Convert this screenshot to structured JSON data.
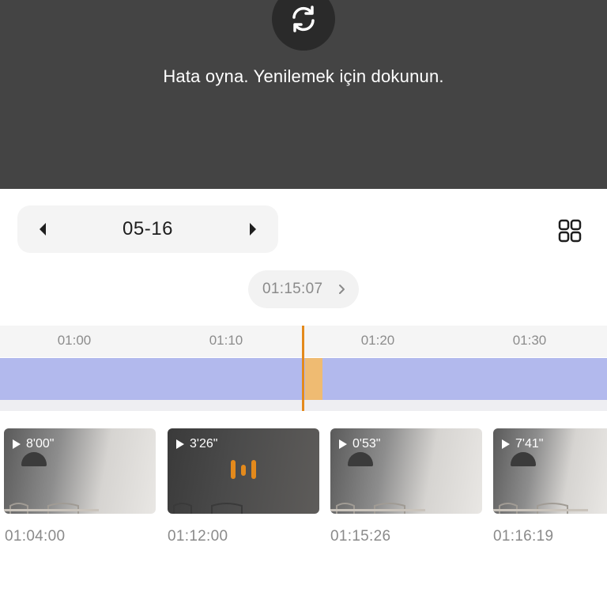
{
  "player": {
    "error_message": "Hata oyna. Yenilemek için dokunun.",
    "refresh_icon": "refresh-icon"
  },
  "date_selector": {
    "date": "05-16",
    "prev_icon": "triangle-left-icon",
    "next_icon": "triangle-right-icon"
  },
  "view_toggle": {
    "icon": "grid-icon"
  },
  "current_time": {
    "label": "01:15:07",
    "icon": "chevron-right-icon"
  },
  "timeline": {
    "ticks": [
      "01:00",
      "01:10",
      "01:20",
      "01:30"
    ],
    "colors": {
      "recording": "#b2b9ed",
      "selected": "#efbb72",
      "playhead": "#e48a1c"
    }
  },
  "clips": [
    {
      "duration": "8'00\"",
      "start": "01:04:00",
      "active": false
    },
    {
      "duration": "3'26\"",
      "start": "01:12:00",
      "active": true
    },
    {
      "duration": "0'53\"",
      "start": "01:15:26",
      "active": false
    },
    {
      "duration": "7'41\"",
      "start": "01:16:19",
      "active": false
    }
  ]
}
